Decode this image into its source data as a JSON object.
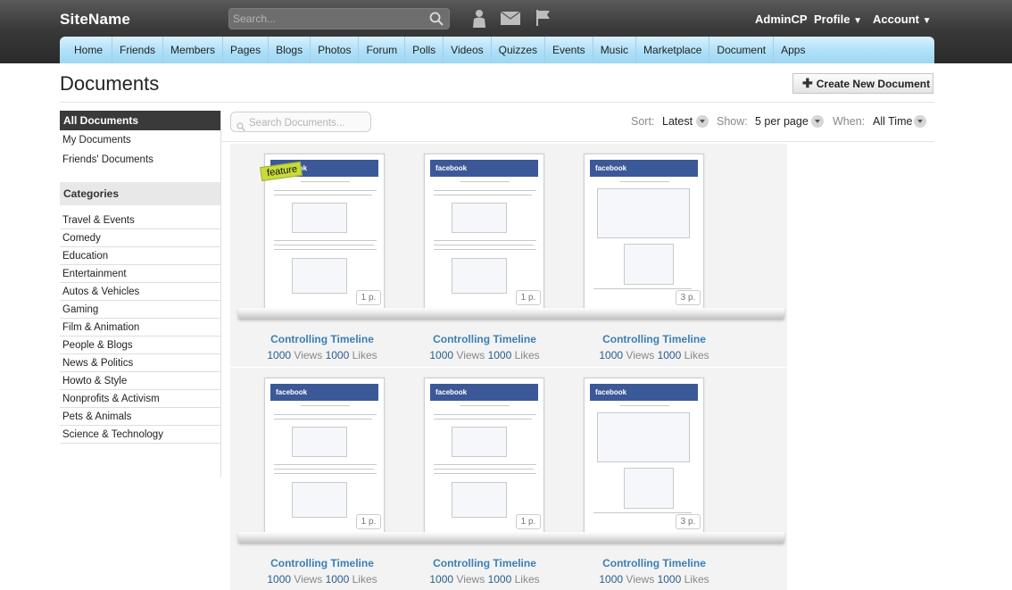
{
  "header": {
    "site_name": "SiteName",
    "search_placeholder": "Search...",
    "links": {
      "admincp": "AdminCP",
      "profile": "Profile",
      "account": "Account"
    }
  },
  "nav": [
    "Home",
    "Friends",
    "Members",
    "Pages",
    "Blogs",
    "Photos",
    "Forum",
    "Polls",
    "Videos",
    "Quizzes",
    "Events",
    "Music",
    "Marketplace",
    "Document",
    "Apps"
  ],
  "page": {
    "title": "Documents",
    "create_button": "Create New Document"
  },
  "sidebar": {
    "views": [
      {
        "label": "All Documents",
        "active": true
      },
      {
        "label": "My Documents"
      },
      {
        "label": "Friends' Documents"
      }
    ],
    "categories_heading": "Categories",
    "categories": [
      "Travel & Events",
      "Comedy",
      "Education",
      "Entertainment",
      "Autos & Vehicles",
      "Gaming",
      "Film & Animation",
      "People & Blogs",
      "News & Politics",
      "Howto & Style",
      "Nonprofits & Activism",
      "Pets & Animals",
      "Science & Technology"
    ]
  },
  "filters": {
    "search_placeholder": "Search Documents...",
    "sort_label": "Sort:",
    "sort_value": "Latest",
    "show_label": "Show:",
    "show_value": "5 per page",
    "when_label": "When:",
    "when_value": "All Time"
  },
  "documents": [
    {
      "title": "Controlling Timeline",
      "views": "1000",
      "views_label": "Views",
      "likes": "1000",
      "likes_label": "Likes",
      "pages": "1 p.",
      "thumb_header": "facebook",
      "featured": true,
      "feature_label": "feature"
    },
    {
      "title": "Controlling Timeline",
      "views": "1000",
      "views_label": "Views",
      "likes": "1000",
      "likes_label": "Likes",
      "pages": "1 p.",
      "thumb_header": "facebook"
    },
    {
      "title": "Controlling Timeline",
      "views": "1000",
      "views_label": "Views",
      "likes": "1000",
      "likes_label": "Likes",
      "pages": "3 p.",
      "thumb_header": "facebook"
    },
    {
      "title": "Controlling Timeline",
      "views": "1000",
      "views_label": "Views",
      "likes": "1000",
      "likes_label": "Likes",
      "pages": "1 p.",
      "thumb_header": "facebook"
    },
    {
      "title": "Controlling Timeline",
      "views": "1000",
      "views_label": "Views",
      "likes": "1000",
      "likes_label": "Likes",
      "pages": "1 p.",
      "thumb_header": "facebook"
    },
    {
      "title": "Controlling Timeline",
      "views": "1000",
      "views_label": "Views",
      "likes": "1000",
      "likes_label": "Likes",
      "pages": "3 p.",
      "thumb_header": "facebook"
    }
  ],
  "colors": {
    "nav_bg": "#aee0f8",
    "header_bg": "#3a3a3a",
    "link": "#3b7fb5",
    "thumb_brand": "#3b5998",
    "feature_tag": "#c8db3c"
  }
}
